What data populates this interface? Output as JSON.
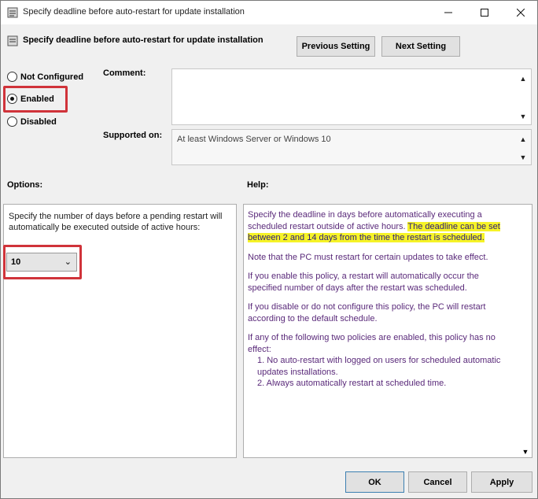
{
  "window": {
    "title": "Specify deadline before auto-restart for update installation",
    "policy_name": "Specify deadline before auto-restart for update installation",
    "minimize_icon": "minimize-icon",
    "maximize_icon": "maximize-icon",
    "close_icon": "close-icon"
  },
  "nav": {
    "previous_label": "Previous Setting",
    "next_label": "Next Setting"
  },
  "state": {
    "options": [
      {
        "label": "Not Configured",
        "checked": false
      },
      {
        "label": "Enabled",
        "checked": true
      },
      {
        "label": "Disabled",
        "checked": false
      }
    ]
  },
  "comment": {
    "label": "Comment:",
    "value": ""
  },
  "supported": {
    "label": "Supported on:",
    "value": "At least Windows Server or Windows 10"
  },
  "options_section": {
    "label": "Options:",
    "description": "Specify the number of days before a pending restart will automatically be executed outside of active hours:",
    "days_value": "10"
  },
  "help_section": {
    "label": "Help:",
    "p1_normal": "Specify the deadline in days before automatically executing a scheduled restart outside of active hours. ",
    "p1_highlight": "The deadline can be set between 2 and 14 days from the time the restart is scheduled.",
    "p2": "Note that the PC must restart for certain updates to take effect.",
    "p3": "If you enable this policy, a restart will automatically occur the specified number of days after the restart was scheduled.",
    "p4": "If you disable or do not configure this policy, the PC will restart according to the default schedule.",
    "p5": "If any of the following two policies are enabled, this policy has no effect:",
    "p5_item1": "1. No auto-restart with logged on users for scheduled automatic updates installations.",
    "p5_item2": "2. Always automatically restart at scheduled time."
  },
  "footer": {
    "ok_label": "OK",
    "cancel_label": "Cancel",
    "apply_label": "Apply"
  },
  "colors": {
    "highlight_border": "#d0333a",
    "help_highlight": "#f6f327"
  }
}
